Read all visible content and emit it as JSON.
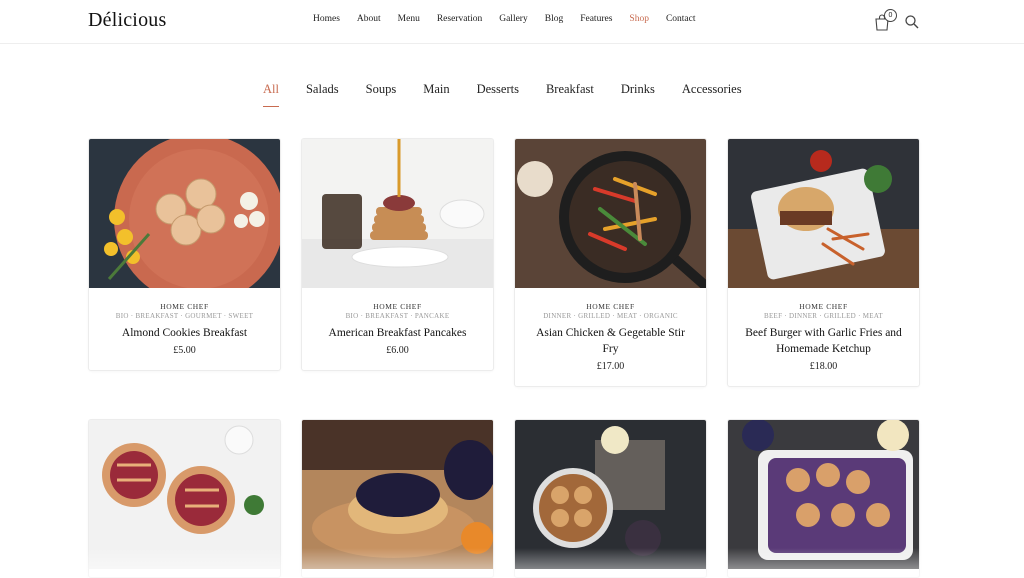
{
  "header": {
    "logo": "Délicious",
    "nav": [
      "Homes",
      "About",
      "Menu",
      "Reservation",
      "Gallery",
      "Blog",
      "Features",
      "Shop",
      "Contact"
    ],
    "active_nav": "Shop",
    "cart_count": "0"
  },
  "filters": [
    "All",
    "Salads",
    "Soups",
    "Main",
    "Desserts",
    "Breakfast",
    "Drinks",
    "Accessories"
  ],
  "active_filter": "All",
  "products": [
    {
      "chef": "HOME CHEF",
      "tags": "BIO · BREAKFAST · GOURMET · SWEET",
      "title": "Almond Cookies Breakfast",
      "price": "£5.00"
    },
    {
      "chef": "HOME CHEF",
      "tags": "BIO · BREAKFAST · PANCAKE",
      "title": "American Breakfast Pancakes",
      "price": "£6.00"
    },
    {
      "chef": "HOME CHEF",
      "tags": "DINNER · GRILLED · MEAT · ORGANIC",
      "title": "Asian Chicken & Gegetable Stir Fry",
      "price": "£17.00"
    },
    {
      "chef": "HOME CHEF",
      "tags": "BEEF · DINNER · GRILLED · MEAT",
      "title": "Beef Burger with Garlic Fries and Homemade Ketchup",
      "price": "£18.00"
    }
  ],
  "colors": {
    "accent": "#c86b50"
  }
}
